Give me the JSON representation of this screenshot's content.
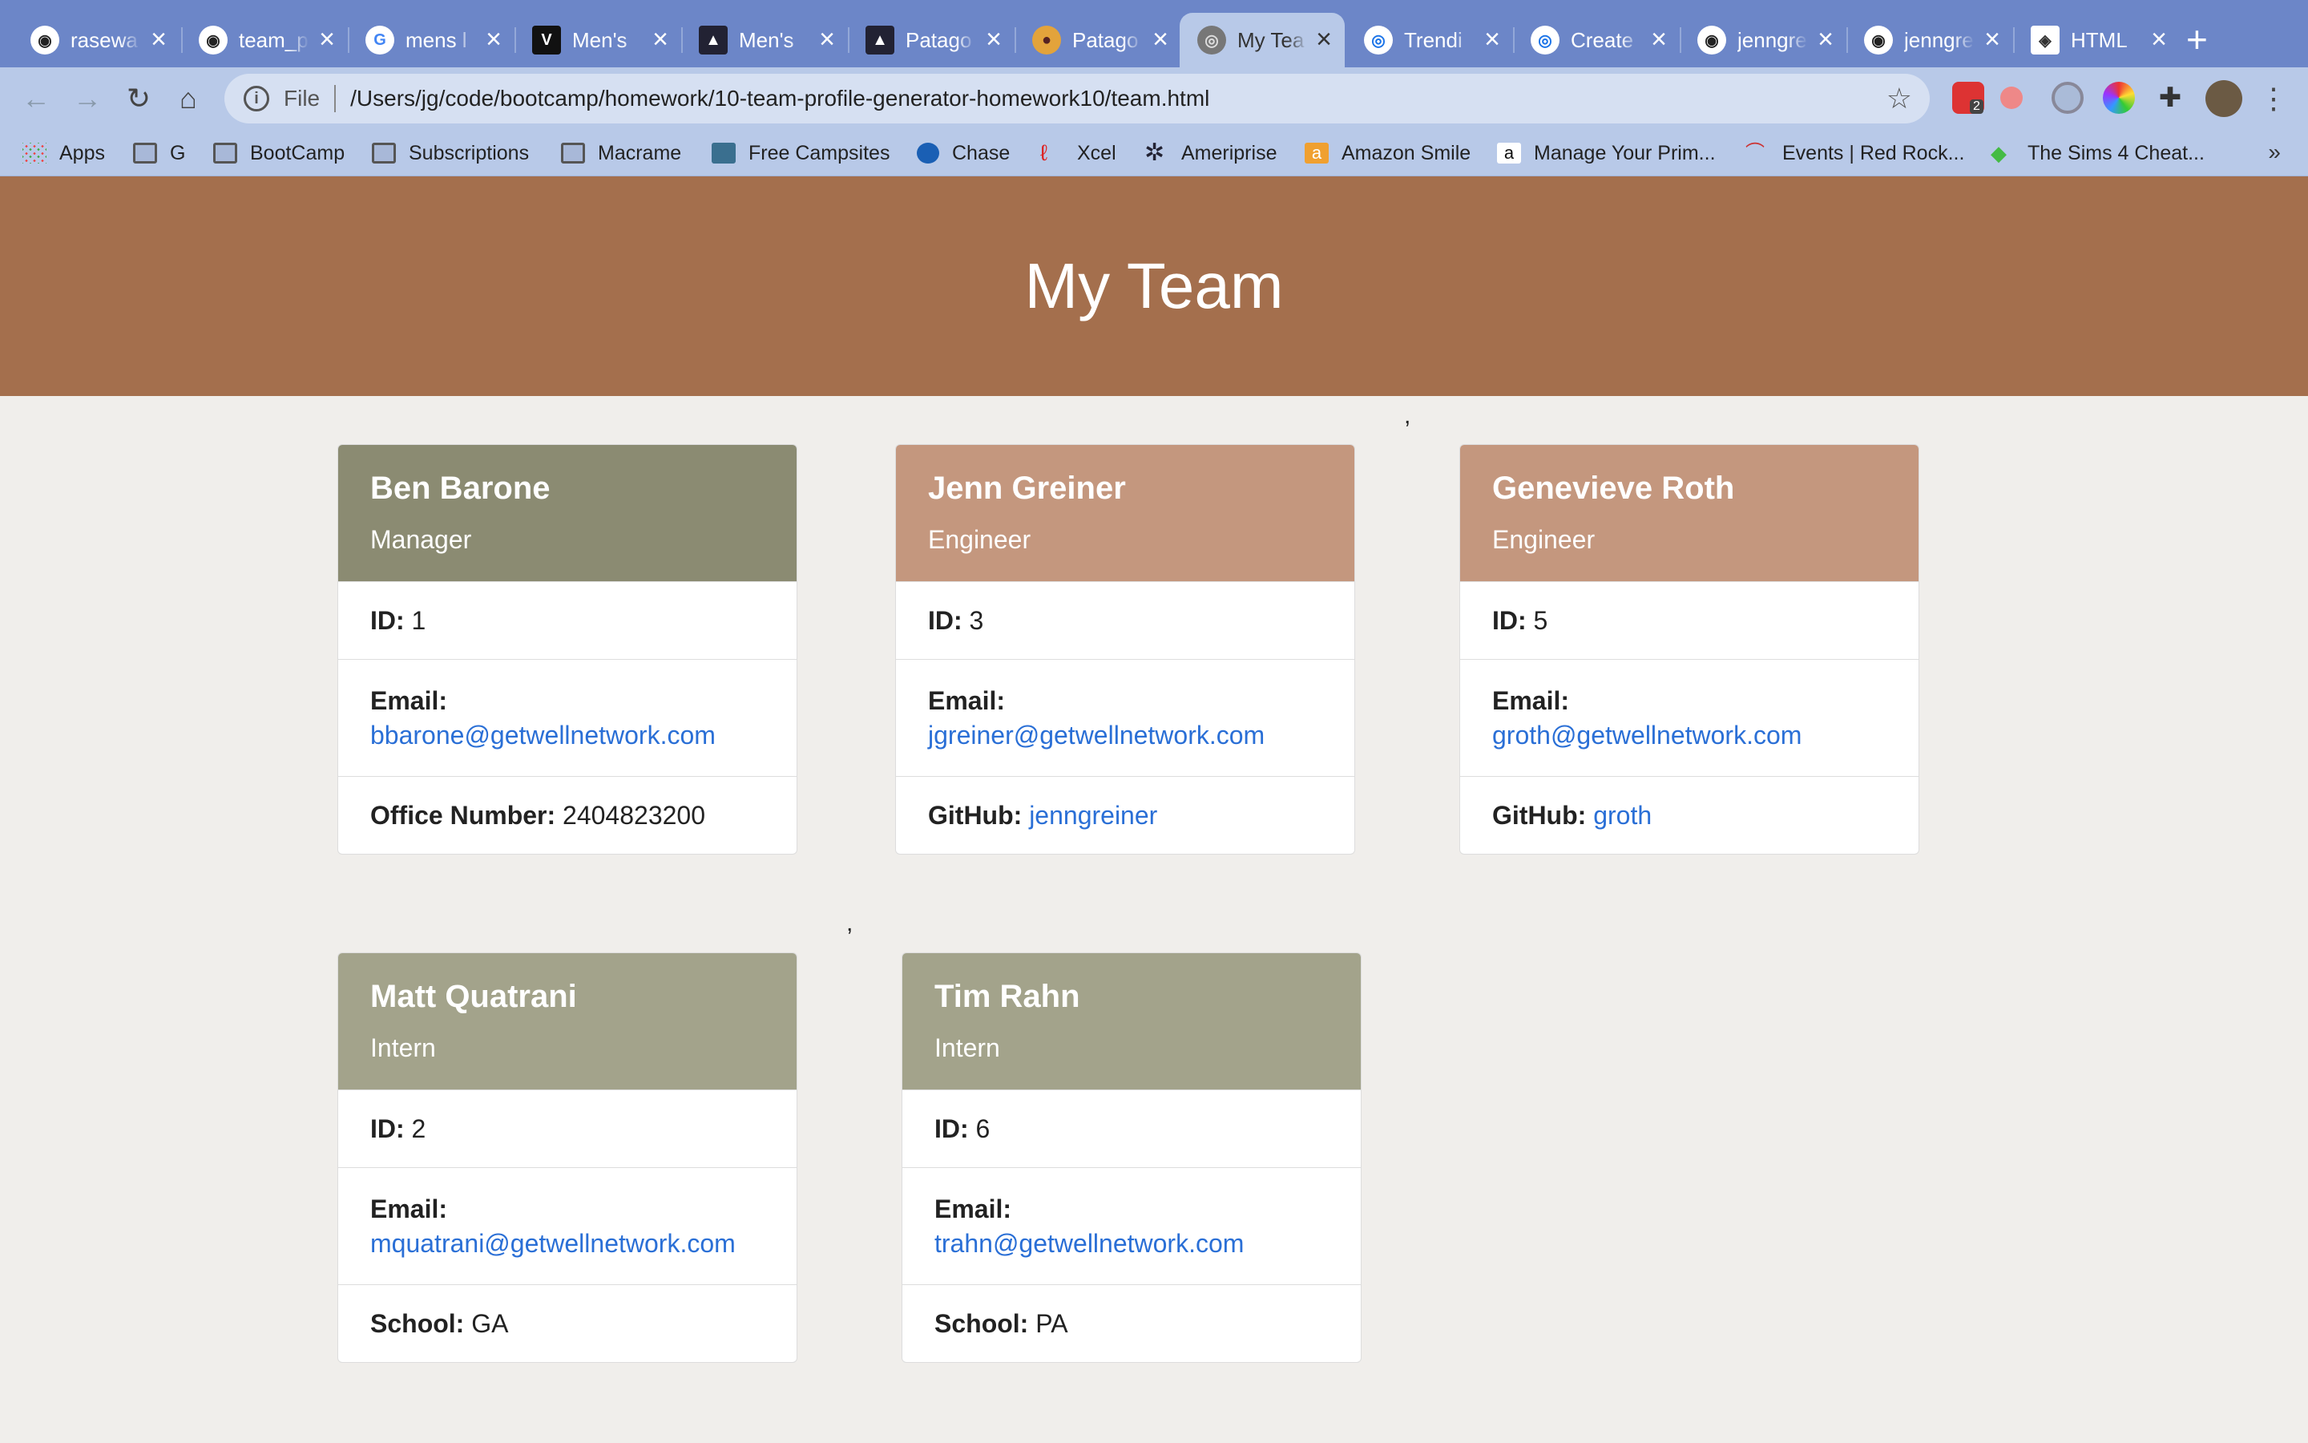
{
  "browser": {
    "tabs": [
      {
        "title": "rasewa",
        "icon": "github-icon"
      },
      {
        "title": "team_p",
        "icon": "github-icon"
      },
      {
        "title": "mens l",
        "icon": "google-icon"
      },
      {
        "title": "Men's",
        "icon": "v-icon"
      },
      {
        "title": "Men's",
        "icon": "patagonia-icon"
      },
      {
        "title": "Patago",
        "icon": "patagonia-icon"
      },
      {
        "title": "Patago",
        "icon": "patagonia-store-icon"
      },
      {
        "title": "My Tea",
        "icon": "globe-icon",
        "active": true
      },
      {
        "title": "Trendi",
        "icon": "chrome-icon"
      },
      {
        "title": "Create",
        "icon": "chrome-icon"
      },
      {
        "title": "jenngre",
        "icon": "github-icon"
      },
      {
        "title": "jenngre",
        "icon": "github-icon"
      },
      {
        "title": "HTML",
        "icon": "html-icon"
      }
    ],
    "new_tab_label": "+",
    "address": {
      "scheme_label": "File",
      "url": "/Users/jg/code/bootcamp/homework/10-team-profile-generator-homework10/team.html"
    },
    "extension_badge": "2",
    "bookmarks": [
      {
        "label": "Apps",
        "icon": "apps-grid-icon"
      },
      {
        "label": "G",
        "icon": "folder-icon"
      },
      {
        "label": "BootCamp",
        "icon": "folder-icon"
      },
      {
        "label": "Subscriptions",
        "icon": "folder-icon"
      },
      {
        "label": "Macrame",
        "icon": "folder-icon"
      },
      {
        "label": "Free Campsites",
        "icon": "campsite-icon"
      },
      {
        "label": "Chase",
        "icon": "chase-icon"
      },
      {
        "label": "Xcel",
        "icon": "xcel-icon"
      },
      {
        "label": "Ameriprise",
        "icon": "ameriprise-icon"
      },
      {
        "label": "Amazon Smile",
        "icon": "amazon-icon"
      },
      {
        "label": "Manage Your Prim...",
        "icon": "amazon-icon"
      },
      {
        "label": "Events | Red Rock...",
        "icon": "redrocks-icon"
      },
      {
        "label": "The Sims 4 Cheat...",
        "icon": "sims-icon"
      }
    ],
    "bookmarks_more": "»"
  },
  "page": {
    "title": "My Team",
    "stray_comma": ",",
    "labels": {
      "id": "ID:",
      "email": "Email:",
      "office": "Office Number:",
      "github": "GitHub:",
      "school": "School:"
    },
    "employees": [
      {
        "name": "Ben Barone",
        "role": "Manager",
        "id": "1",
        "email": "bbarone@getwellnetwork.com",
        "office": "2404823200"
      },
      {
        "name": "Jenn Greiner",
        "role": "Engineer",
        "id": "3",
        "email": "jgreiner@getwellnetwork.com",
        "github": "jenngreiner"
      },
      {
        "name": "Genevieve Roth",
        "role": "Engineer",
        "id": "5",
        "email": "groth@getwellnetwork.com",
        "github": "groth"
      },
      {
        "name": "Matt Quatrani",
        "role": "Intern",
        "id": "2",
        "email": "mquatrani@getwellnetwork.com",
        "school": "GA"
      },
      {
        "name": "Tim Rahn",
        "role": "Intern",
        "id": "6",
        "email": "trahn@getwellnetwork.com",
        "school": "PA"
      }
    ]
  },
  "colors": {
    "tabstrip": "#6c86c8",
    "toolbar": "#b8c9e8",
    "jumbotron": "#a46f4d",
    "manager_header": "#8b8b72",
    "engineer_header": "#c4977e",
    "intern_header": "#a3a38b",
    "link": "#2a6fd6",
    "page_bg": "#f0eeeb"
  }
}
